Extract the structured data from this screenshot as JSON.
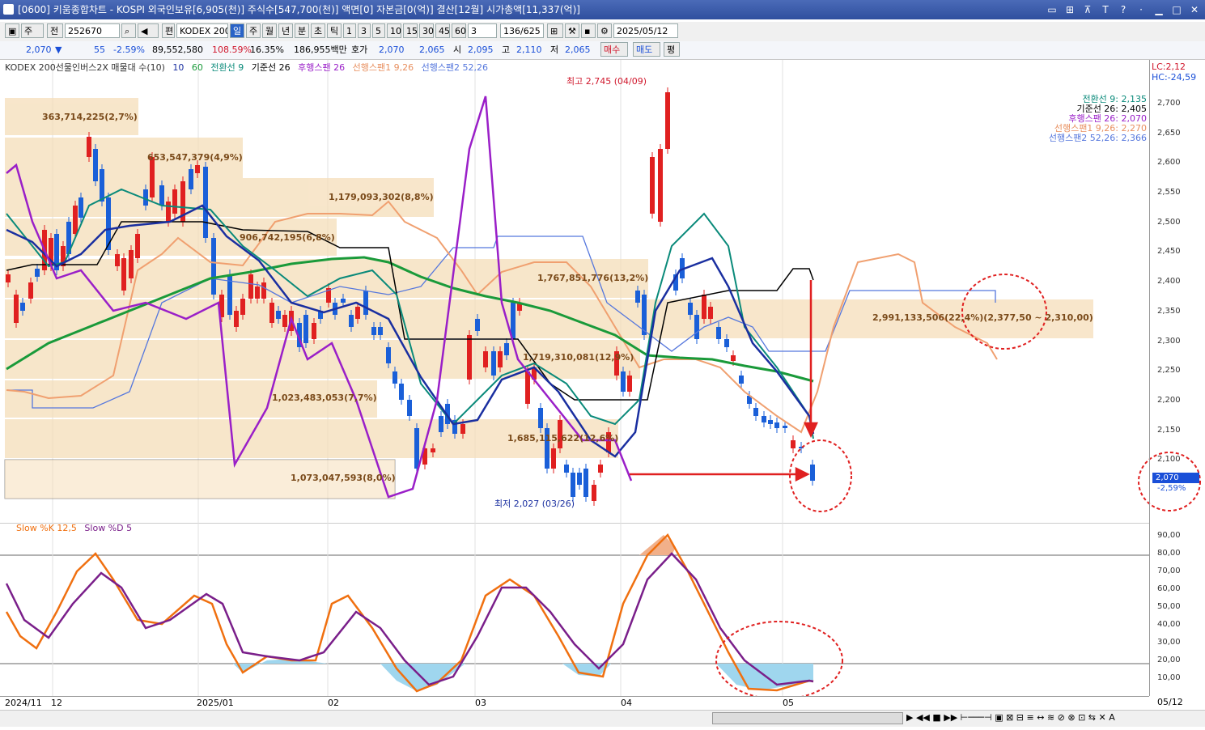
{
  "window": {
    "title": "[0600] 키움종합차트 - KOSPI 외국인보유[6,905(천)] 주식수[547,700(천)] 액면[0] 자본금[0(억)] 결산[12월] 시가총액[11,337(억)]"
  },
  "toolbar": {
    "period": "주",
    "prev": "전",
    "code": "252670",
    "name": "KODEX 200선",
    "edit": "편",
    "tabs": [
      "일",
      "주",
      "월",
      "년",
      "분",
      "초",
      "틱"
    ],
    "nums": [
      "1",
      "3",
      "5",
      "10",
      "15",
      "30",
      "45",
      "60"
    ],
    "count_sel": "3",
    "range": "136/625",
    "date": "2025/05/12"
  },
  "quote": {
    "price": "2,070",
    "arrow": "▼",
    "change": "55",
    "rate": "-2.59%",
    "volume": "89,552,580",
    "vol_ratio": "108.59%",
    "turnover": "16.35%",
    "amount": "186,955백만",
    "hoga_label": "호가",
    "hoga_ask": "2,070",
    "hoga_bid": "2,065",
    "open_label": "시",
    "open": "2,095",
    "high_label": "고",
    "high": "2,110",
    "low_label": "저",
    "low": "2,065",
    "buy": "매수",
    "sell": "매도",
    "eval": "평"
  },
  "legend": {
    "title": "KODEX 200선물인버스2X 매물대 수(10)",
    "p1": "10",
    "p2": "60",
    "conv": "전환선 9",
    "base": "기준선 26",
    "lag": "후행스팬 26",
    "lead1": "선행스팬1 9,26",
    "lead2": "선행스팬2 52,26"
  },
  "right_axis": {
    "lc": "LC:2,12",
    "hc": "HC:-24,59",
    "labels": [
      "2,700",
      "2,650",
      "2,600",
      "2,550",
      "2,500",
      "2,450",
      "2,400",
      "2,350",
      "2,300",
      "2,250",
      "2,200",
      "2,150",
      "2,100"
    ],
    "current": "2,070",
    "current_rate": "-2,59%",
    "stoch_labels": [
      "90,00",
      "80,00",
      "70,00",
      "60,00",
      "50,00",
      "40,00",
      "30,00",
      "20,00",
      "10,00"
    ]
  },
  "indicators": [
    {
      "text": "전환선 9: 2,135",
      "color": "#0a8a7a"
    },
    {
      "text": "기준선 26: 2,405",
      "color": "#000000"
    },
    {
      "text": "후행스팬 26: 2,070",
      "color": "#9a1fc8"
    },
    {
      "text": "선행스팬1 9,26: 2,270",
      "color": "#f0a070"
    },
    {
      "text": "선행스팬2 52,26: 2,366",
      "color": "#5577dd"
    }
  ],
  "volume_profile": [
    "363,714,225(2,7%)",
    "653,547,379(4,9%)",
    "1,179,093,302(8,8%)",
    "906,742,195(6,8%)",
    "1,767,851,776(13,2%)",
    "2,991,133,506(22,4%)(2,377,50 ~ 2,310,00)",
    "1,719,310,081(12,9%)",
    "1,023,483,053(7,7%)",
    "1,685,115,622(12,6%)",
    "1,073,047,593(8,0%)"
  ],
  "annotations": {
    "high": "최고 2,745 (04/09)",
    "low": "최저 2,027 (03/26)"
  },
  "stoch_legend": {
    "k": "Slow %K 12,5",
    "d": "Slow %D 5"
  },
  "xaxis": [
    "2024/11",
    "12",
    "2025/01",
    "02",
    "03",
    "04",
    "05"
  ],
  "xaxis_right": "05/12",
  "colors": {
    "up": "#e02020",
    "down": "#1a5fd8",
    "conv": "#0a8a7a",
    "base": "#000000",
    "lag": "#9a1fc8",
    "lead1": "#f0a070",
    "lead2": "#5577dd",
    "ma60": "#1a9a3a",
    "ma10": "#1a2fa0"
  }
}
